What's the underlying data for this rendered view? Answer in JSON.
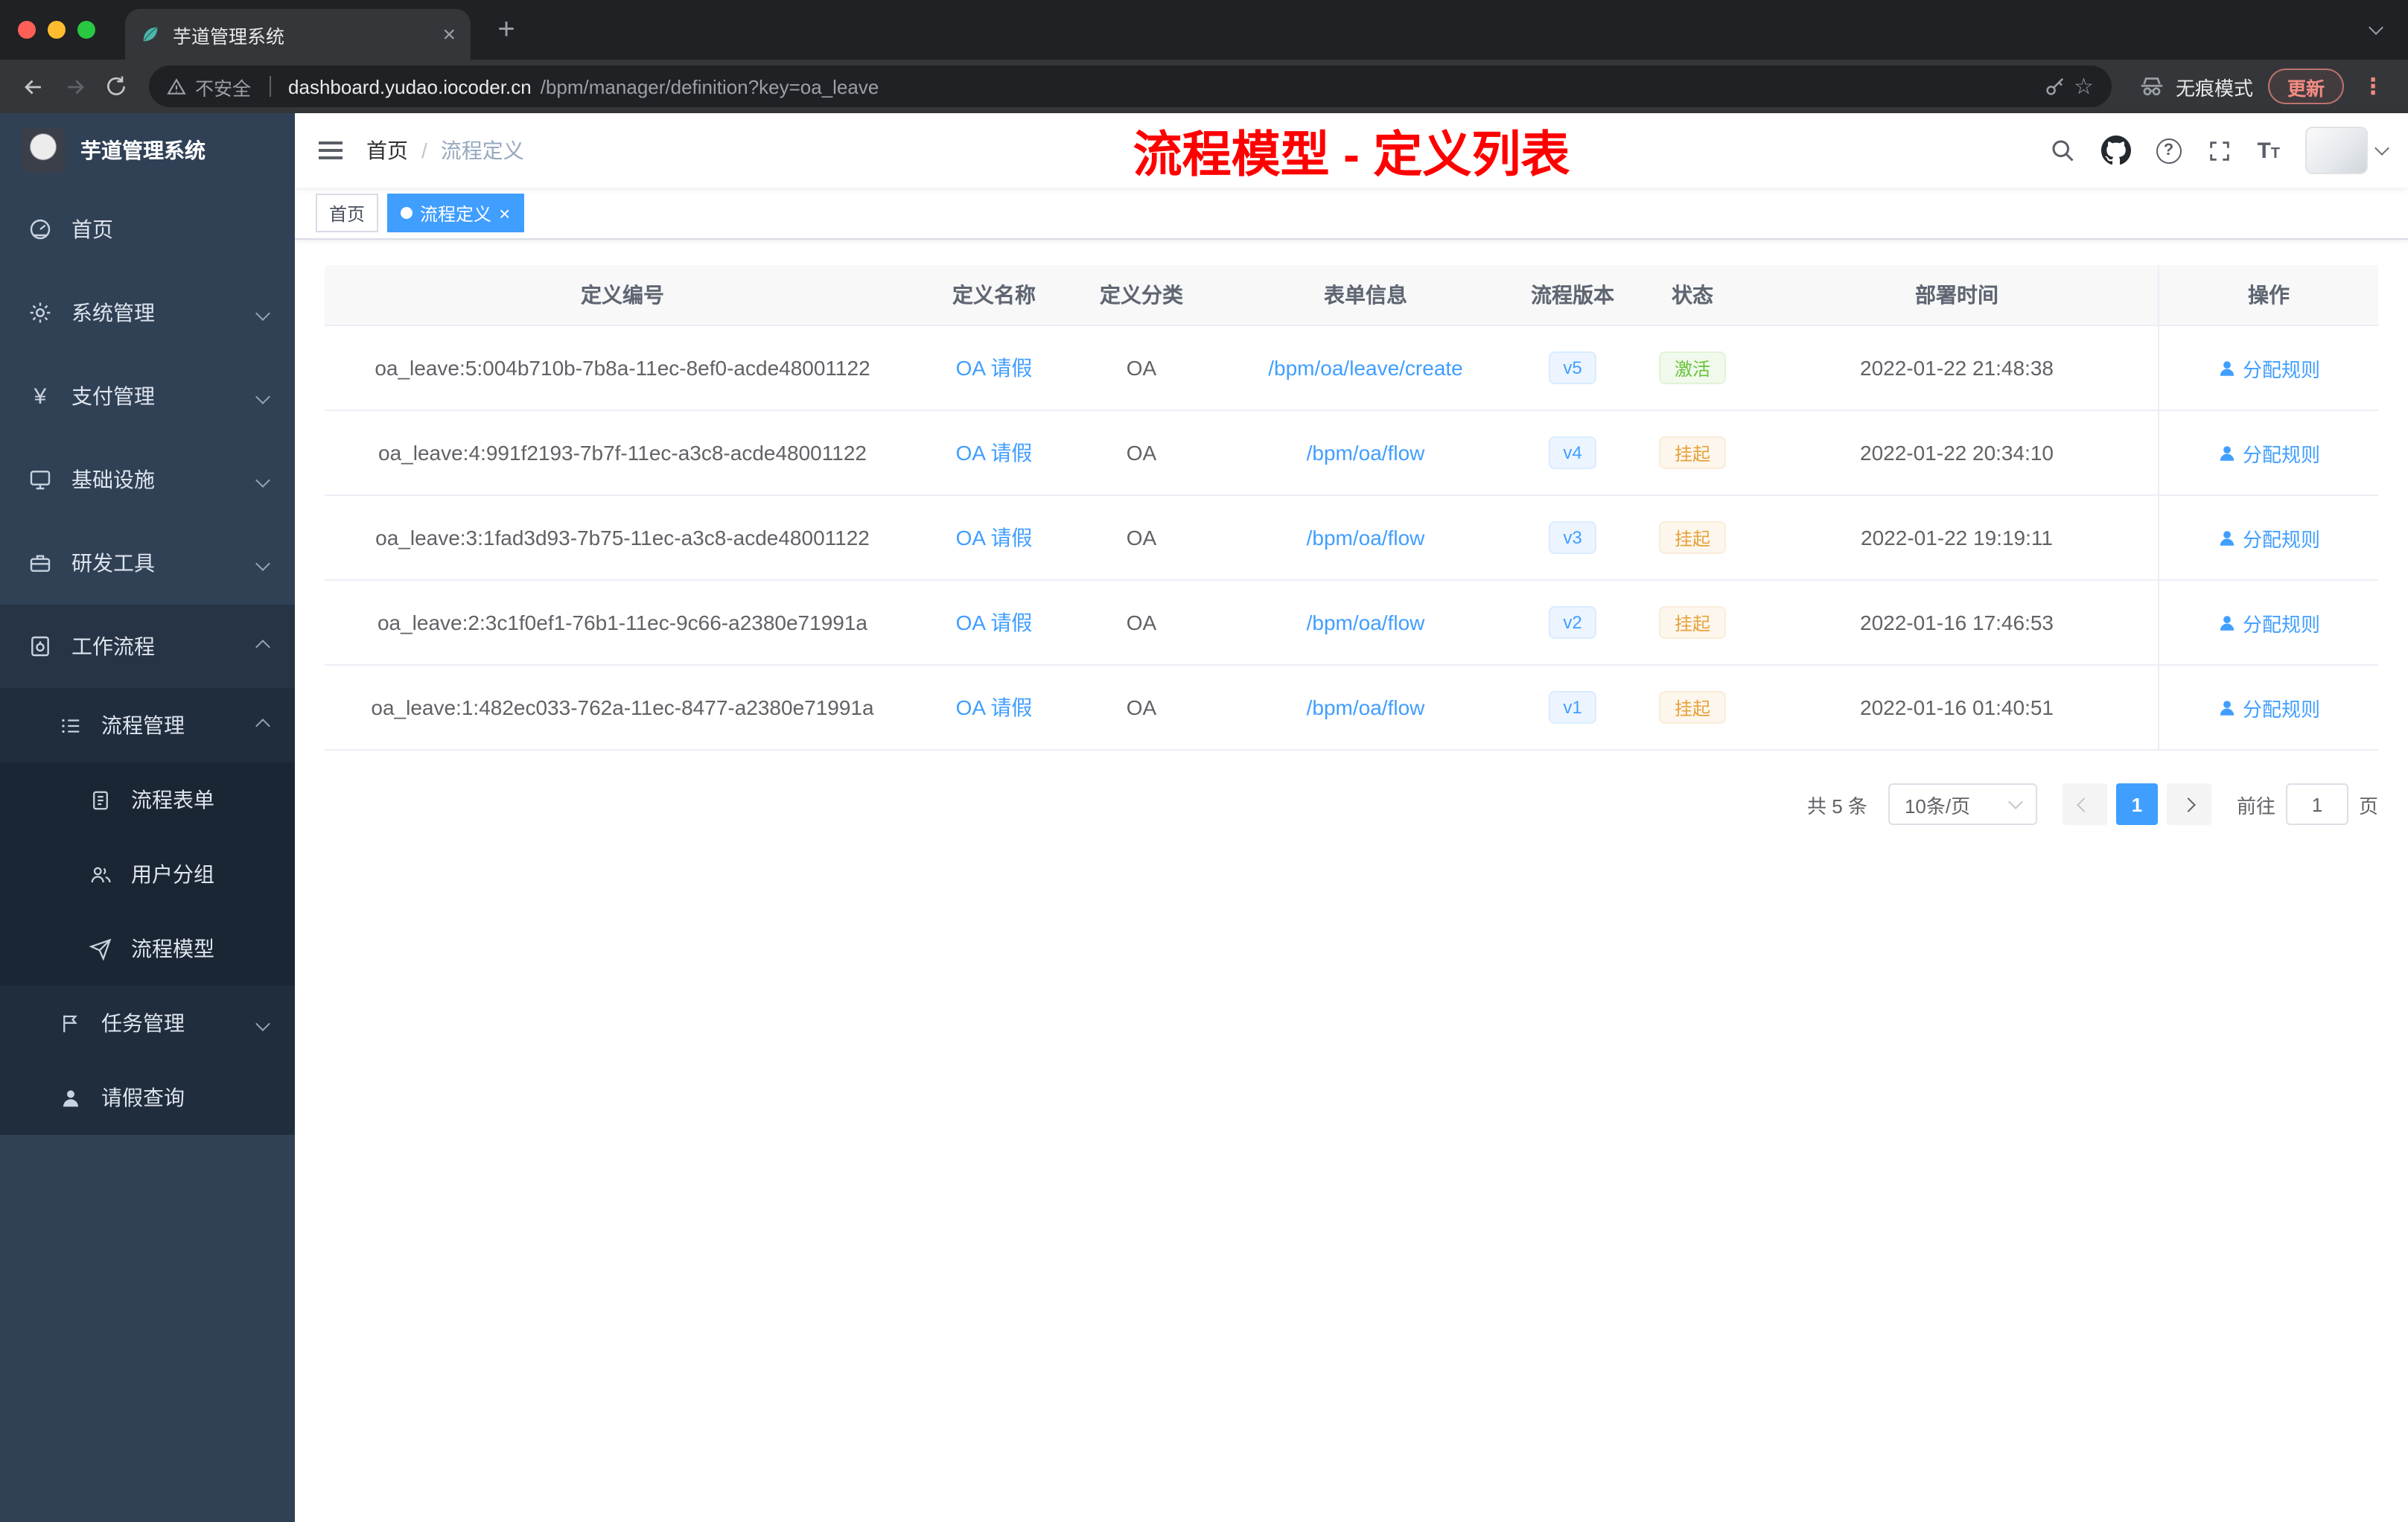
{
  "browser": {
    "tab_title": "芋道管理系统",
    "new_tab_label": "+",
    "security_label": "不安全",
    "url_host": "dashboard.yudao.iocoder.cn",
    "url_path": "/bpm/manager/definition?key=oa_leave",
    "incognito_label": "无痕模式",
    "update_label": "更新"
  },
  "sidebar": {
    "app_title": "芋道管理系统",
    "items": [
      {
        "label": "首页",
        "icon": "dashboard-icon"
      },
      {
        "label": "系统管理",
        "icon": "gear-icon"
      },
      {
        "label": "支付管理",
        "icon": "yen-icon"
      },
      {
        "label": "基础设施",
        "icon": "monitor-icon"
      },
      {
        "label": "研发工具",
        "icon": "toolbox-icon"
      },
      {
        "label": "工作流程",
        "icon": "workflow-icon"
      },
      {
        "label": "流程管理",
        "icon": "list-icon"
      },
      {
        "label": "流程表单",
        "icon": "form-icon"
      },
      {
        "label": "用户分组",
        "icon": "users-icon"
      },
      {
        "label": "流程模型",
        "icon": "paper-plane-icon"
      },
      {
        "label": "任务管理",
        "icon": "flag-icon"
      },
      {
        "label": "请假查询",
        "icon": "user-icon"
      }
    ]
  },
  "navbar": {
    "breadcrumb_home": "首页",
    "breadcrumb_separator": "/",
    "breadcrumb_current": "流程定义",
    "annotation_title": "流程模型 - 定义列表"
  },
  "tags": {
    "home": "首页",
    "active": "流程定义",
    "close": "×"
  },
  "table": {
    "headers": [
      "定义编号",
      "定义名称",
      "定义分类",
      "表单信息",
      "流程版本",
      "状态",
      "部署时间",
      "操作"
    ],
    "rows": [
      {
        "id": "oa_leave:5:004b710b-7b8a-11ec-8ef0-acde48001122",
        "name": "OA 请假",
        "category": "OA",
        "form": "/bpm/oa/leave/create",
        "version": "v5",
        "status": "激活",
        "deploy_time": "2022-01-22 21:48:38",
        "action": "分配规则"
      },
      {
        "id": "oa_leave:4:991f2193-7b7f-11ec-a3c8-acde48001122",
        "name": "OA 请假",
        "category": "OA",
        "form": "/bpm/oa/flow",
        "version": "v4",
        "status": "挂起",
        "deploy_time": "2022-01-22 20:34:10",
        "action": "分配规则"
      },
      {
        "id": "oa_leave:3:1fad3d93-7b75-11ec-a3c8-acde48001122",
        "name": "OA 请假",
        "category": "OA",
        "form": "/bpm/oa/flow",
        "version": "v3",
        "status": "挂起",
        "deploy_time": "2022-01-22 19:19:11",
        "action": "分配规则"
      },
      {
        "id": "oa_leave:2:3c1f0ef1-76b1-11ec-9c66-a2380e71991a",
        "name": "OA 请假",
        "category": "OA",
        "form": "/bpm/oa/flow",
        "version": "v2",
        "status": "挂起",
        "deploy_time": "2022-01-16 17:46:53",
        "action": "分配规则"
      },
      {
        "id": "oa_leave:1:482ec033-762a-11ec-8477-a2380e71991a",
        "name": "OA 请假",
        "category": "OA",
        "form": "/bpm/oa/flow",
        "version": "v1",
        "status": "挂起",
        "deploy_time": "2022-01-16 01:40:51",
        "action": "分配规则"
      }
    ]
  },
  "pagination": {
    "total_label": "共 5 条",
    "page_size": "10条/页",
    "current_page": "1",
    "goto_label": "前往",
    "goto_value": "1",
    "page_unit_label": "页"
  },
  "colors": {
    "accent": "#409eff",
    "success": "#67c23a",
    "warning": "#e6a23c",
    "annotation": "#ff0000",
    "sidebar_bg": "#304156"
  }
}
